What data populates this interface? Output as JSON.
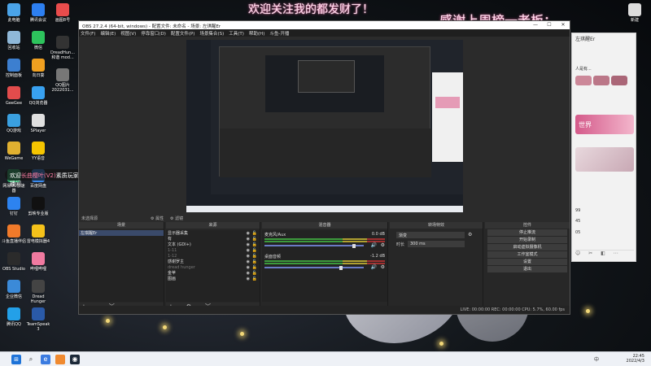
{
  "overlay": {
    "banner_left": "欢迎关注我的都发财了！",
    "banner_right": "感谢上周榜一老板：",
    "chat_toast_prefix": "欢迎",
    "chat_toast_user": "长曲樱叶(V2)",
    "chat_toast_suffix": "素质玩家左琪醒Er进入直播间"
  },
  "desktop": {
    "icons_left": [
      {
        "label": "此电脑",
        "color": "#4aa3e8"
      },
      {
        "label": "回收站",
        "color": "#8fb8d8"
      },
      {
        "label": "控制面板",
        "color": "#3c7fd0"
      },
      {
        "label": "GeeGee",
        "color": "#e24c4c"
      },
      {
        "label": "QQ游戏",
        "color": "#3aa0e0"
      },
      {
        "label": "WeGame",
        "color": "#e0b030"
      },
      {
        "label": "网易UU加速器",
        "color": "#2fb06c"
      },
      {
        "label": "钉钉",
        "color": "#2d83f0"
      },
      {
        "label": "斗鱼直播伴侣",
        "color": "#f07a2a"
      },
      {
        "label": "OBS Studio",
        "color": "#2b2b2b"
      },
      {
        "label": "企业微信",
        "color": "#3b8ad8"
      },
      {
        "label": "腾讯QQ",
        "color": "#23a0e8"
      }
    ],
    "icons_col2": [
      {
        "label": "腾讯会议",
        "color": "#2d7ff0"
      },
      {
        "label": "微信",
        "color": "#2dc35c"
      },
      {
        "label": "向日葵",
        "color": "#f0a020"
      },
      {
        "label": "QQ浏览器",
        "color": "#38a1f0"
      },
      {
        "label": "SPlayer",
        "color": "#e0e0e0"
      },
      {
        "label": "YY语音",
        "color": "#f5c500"
      },
      {
        "label": "百度网盘",
        "color": "#3b8cf0"
      },
      {
        "label": "剪映专业版",
        "color": "#111111"
      },
      {
        "label": "雷电模拟器4",
        "color": "#f5c21a"
      },
      {
        "label": "哔哩哔哩",
        "color": "#f07aa0"
      },
      {
        "label": "Dread Hunger",
        "color": "#444444"
      },
      {
        "label": "TeamSpeak 3",
        "color": "#2a5aa8"
      }
    ],
    "icons_col3": [
      {
        "label": "画图8号",
        "color": "#e84c4c"
      },
      {
        "label": "DreadHun... 和谐 mod...",
        "color": "#333333"
      },
      {
        "label": "QQ图片 2022031...",
        "color": "#777777"
      }
    ],
    "icon_right_top": {
      "label": "新建",
      "color": "#dddddd"
    }
  },
  "obs": {
    "title": "OBS 27.2.4 (64-bit, windows) - 配置文件: 未命名 - 场景: 左琪醒Er",
    "menu": [
      "文件(F)",
      "编辑(E)",
      "视图(V)",
      "停靠窗口(D)",
      "配置文件(P)",
      "场景集合(S)",
      "工具(T)",
      "帮助(H)",
      "斗鱼-开播"
    ],
    "win_min": "—",
    "win_max": "☐",
    "win_close": "✕",
    "preview_label": "未选择源",
    "props_button": "属性",
    "filters_button": "滤镜",
    "docks": {
      "scenes_title": "场景",
      "sources_title": "来源",
      "mixer_title": "混音器",
      "transitions_title": "转场特效",
      "controls_title": "控件"
    },
    "scene_items": [
      "左琪醒Er"
    ],
    "sources": [
      {
        "name": "显示器采集",
        "dim": false
      },
      {
        "name": "有",
        "dim": false
      },
      {
        "name": "文本 (GDI+)",
        "dim": false
      },
      {
        "name": "1-11",
        "dim": true
      },
      {
        "name": "1-12",
        "dim": true
      },
      {
        "name": "感谢罗主",
        "dim": false
      },
      {
        "name": "dread hunger",
        "dim": true
      },
      {
        "name": "金苹",
        "dim": false
      },
      {
        "name": "图画",
        "dim": false
      }
    ],
    "mixer": [
      {
        "name": "麦克风/Aux",
        "db": "0.0 dB",
        "level": 0.73
      },
      {
        "name": "桌面音频",
        "db": "-1.2 dB",
        "level": 0.62
      }
    ],
    "transition": {
      "type": "渐变",
      "duration_label": "时长",
      "duration_value": "300 ms"
    },
    "controls": [
      "停止推流",
      "开始录制",
      "启动虚拟摄像机",
      "工作室模式",
      "设置",
      "退出"
    ],
    "status": "LIVE: 00:00:00   REC: 00:00:00   CPU: 5.7%, 60.00 fps"
  },
  "chat_panel": {
    "title": "左琪醒Er",
    "line1": "人是有...",
    "badge": "世界",
    "num1": "99",
    "num2": "45",
    "num3": "05"
  },
  "taskbar": {
    "time": "22:45",
    "date": "2022/4/3",
    "tray_text": "中"
  }
}
